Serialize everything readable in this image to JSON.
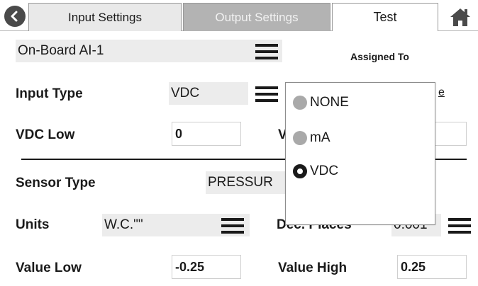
{
  "tabs": {
    "input_settings": "Input Settings",
    "output_settings": "Output Settings",
    "test": "Test"
  },
  "icons": {
    "back": "chevron-left-icon",
    "home": "home-icon",
    "menu": "hamburger-icon"
  },
  "input_select": {
    "value": "On-Board AI-1"
  },
  "assigned_to": {
    "label": "Assigned To"
  },
  "input_type": {
    "label": "Input Type",
    "value": "VDC"
  },
  "vdc_low": {
    "label": "VDC Low",
    "value": "0"
  },
  "vdc_high_partial": {
    "label": "V"
  },
  "hidden_link_partial": {
    "text": "e"
  },
  "sensor_type": {
    "label": "Sensor Type",
    "value": "PRESSUR"
  },
  "units": {
    "label": "Units",
    "value": "W.C.\"\""
  },
  "dec_places": {
    "label": "Dec. Places",
    "value": "0.001"
  },
  "value_low": {
    "label": "Value Low",
    "value": "-0.25"
  },
  "value_high": {
    "label": "Value High",
    "value": "0.25"
  },
  "dropdown": {
    "options": [
      {
        "label": "NONE",
        "selected": false
      },
      {
        "label": "mA",
        "selected": false
      },
      {
        "label": "VDC",
        "selected": true
      }
    ]
  },
  "colors": {
    "tab_active_bg": "#e9e9e9",
    "tab_disabled_bg": "#b3b3b3",
    "field_bg": "#ececec",
    "radio_off": "#a9a9a9",
    "text": "#1a1a1a"
  }
}
